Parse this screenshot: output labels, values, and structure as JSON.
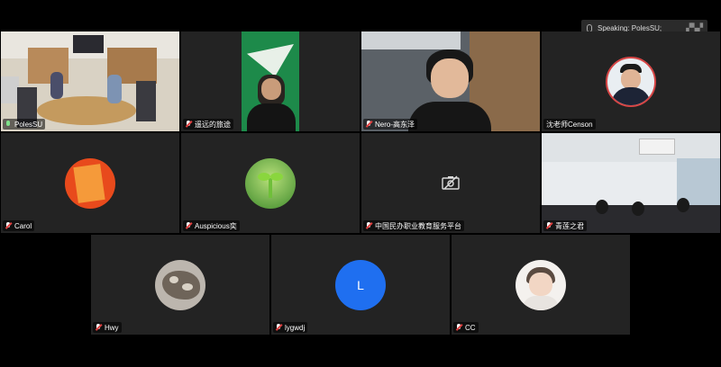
{
  "speaking": {
    "label": "Speaking: PolesSU;",
    "view_icon": "gallery-view-icon"
  },
  "tiles": [
    {
      "name": "PolesSU",
      "mic": "active"
    },
    {
      "name": "遥远的旅途",
      "mic": "muted"
    },
    {
      "name": "Nero-高东泽",
      "mic": "muted"
    },
    {
      "name": "沈老师Censon",
      "mic": "none"
    },
    {
      "name": "Carol",
      "mic": "muted"
    },
    {
      "name": "Auspicious奕",
      "mic": "muted"
    },
    {
      "name": "中国民办职业教育服务平台",
      "mic": "muted"
    },
    {
      "name": "青莲之君",
      "mic": "muted"
    },
    {
      "name": "Hwy",
      "mic": "muted"
    },
    {
      "name": "lygwdj",
      "mic": "muted"
    },
    {
      "name": "CC",
      "mic": "muted"
    }
  ],
  "avatars": {
    "lygwdj_letter": "L"
  },
  "colors": {
    "active_speaker": "#7ee08a",
    "tile_bg": "#232323",
    "letter_avatar": "#1f6ff0",
    "muted": "#e04040"
  }
}
